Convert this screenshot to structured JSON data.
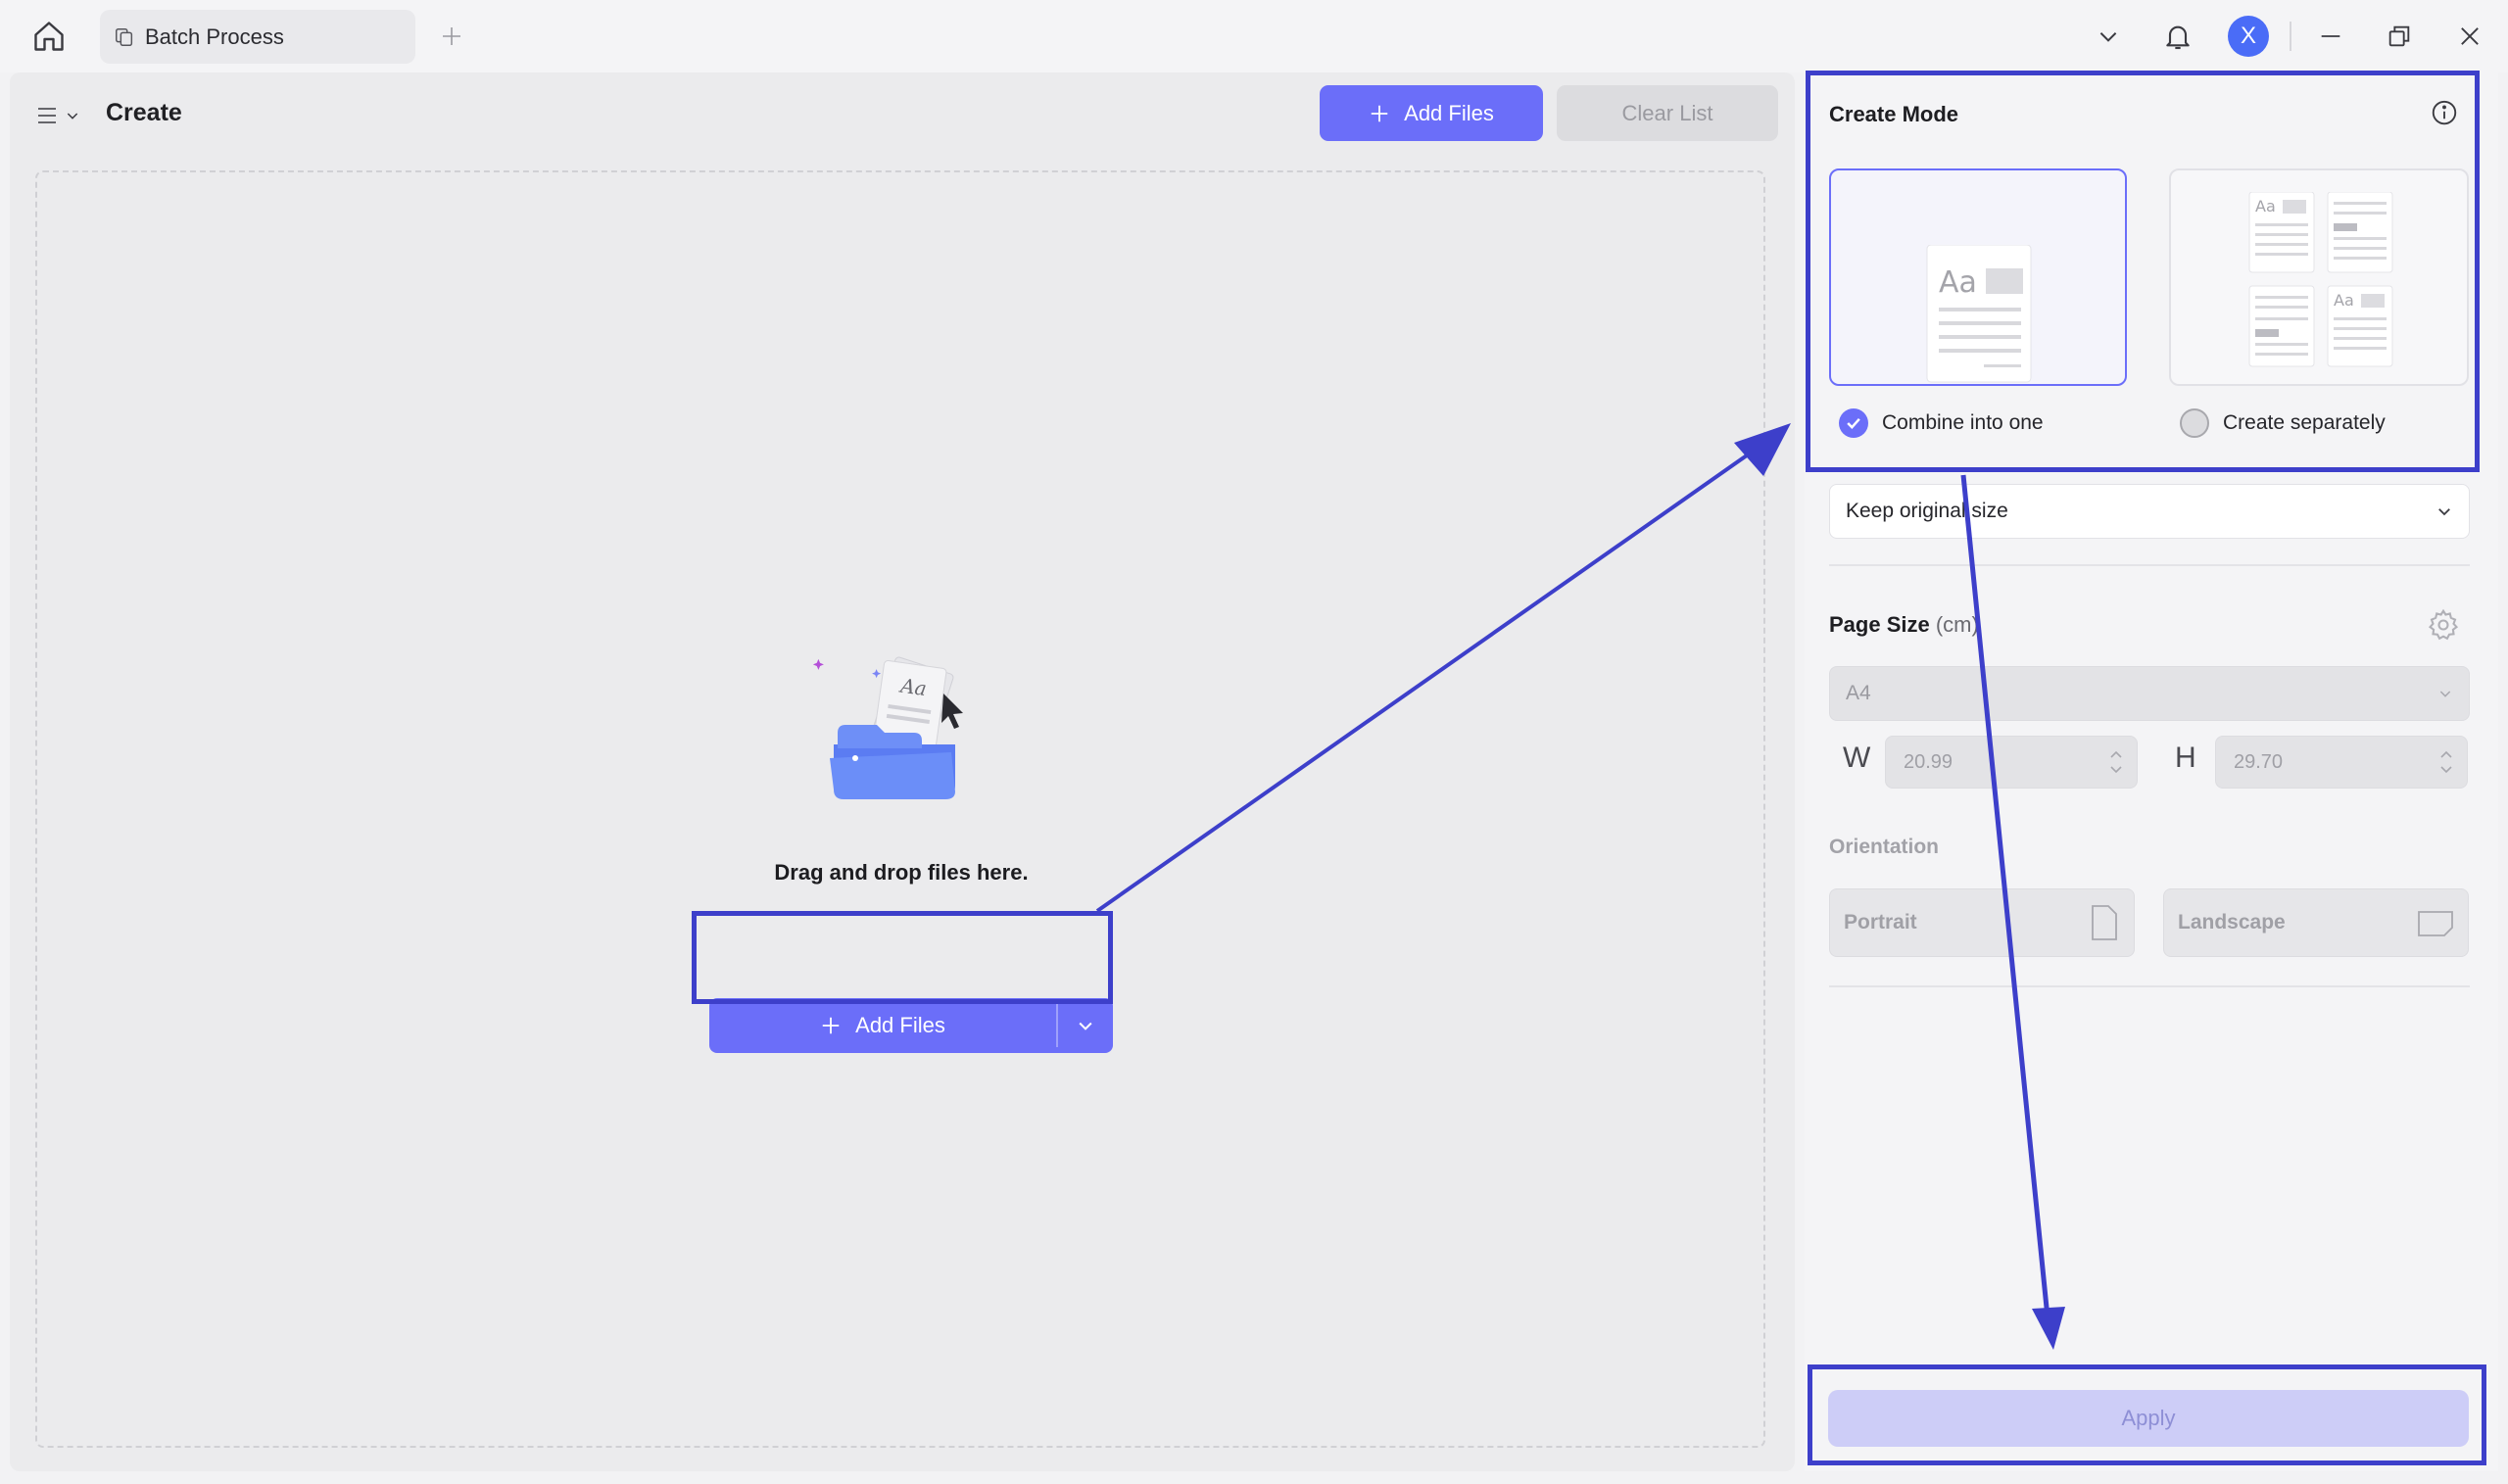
{
  "titlebar": {
    "tab_label": "Batch Process",
    "avatar_initial": "X"
  },
  "main": {
    "title": "Create",
    "add_files_label": "Add Files",
    "clear_list_label": "Clear List",
    "drop_text": "Drag and drop files here.",
    "center_add_files_label": "Add Files"
  },
  "panel": {
    "create_mode_title": "Create Mode",
    "combine_label": "Combine into one",
    "separate_label": "Create separately",
    "size_option": "Keep original size",
    "page_size_title": "Page Size",
    "page_size_unit": "(cm)",
    "page_size_value": "A4",
    "width_label": "W",
    "width_value": "20.99",
    "height_label": "H",
    "height_value": "29.70",
    "orientation_title": "Orientation",
    "portrait_label": "Portrait",
    "landscape_label": "Landscape",
    "apply_label": "Apply",
    "selected_mode": "combine"
  },
  "colors": {
    "accent": "#6b6ef9",
    "annotation": "#3d3fca"
  },
  "icons": {
    "home": "home-icon",
    "tab": "batch-icon",
    "bell": "bell-icon",
    "info": "info-icon",
    "gear": "gear-icon"
  }
}
